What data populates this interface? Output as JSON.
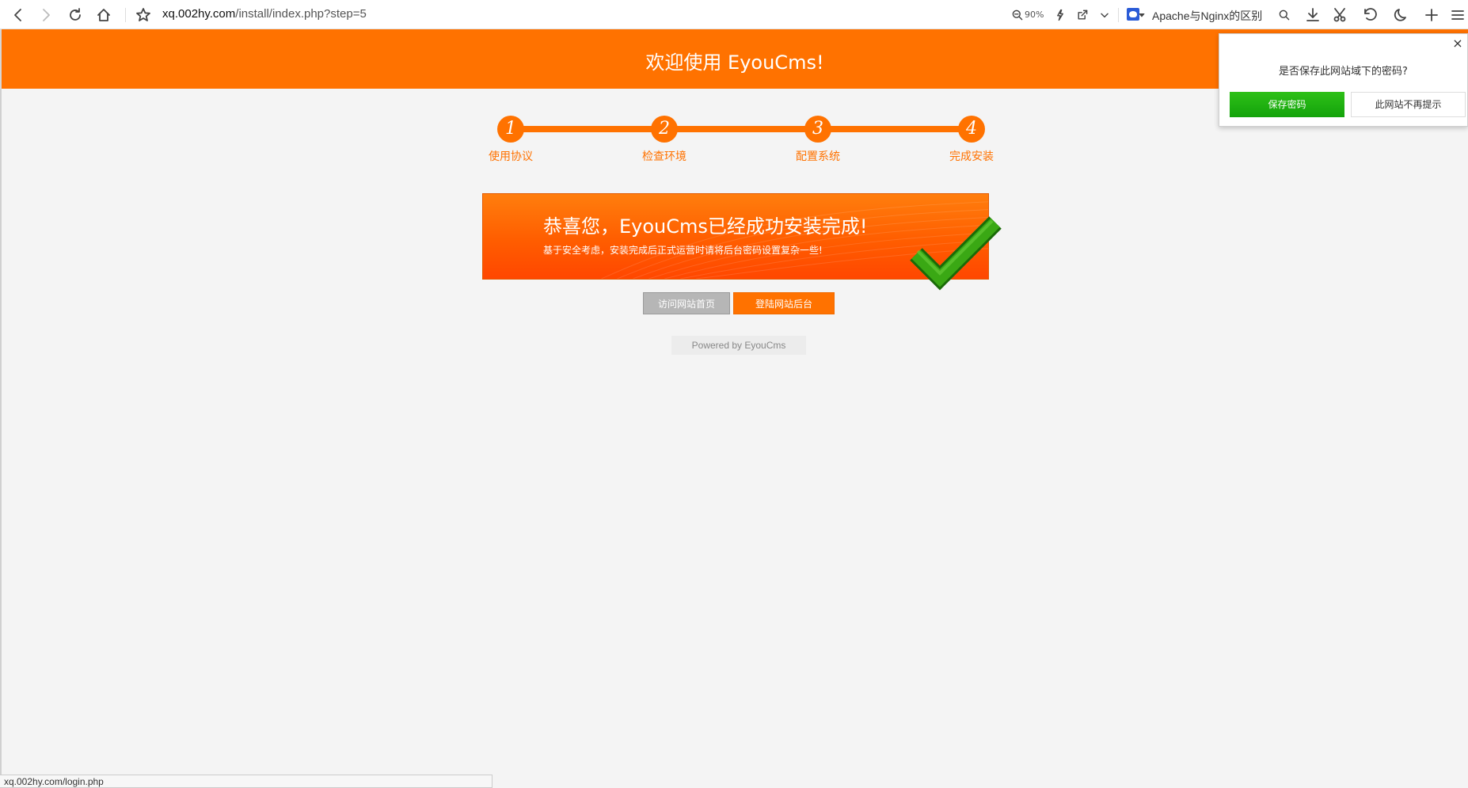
{
  "browser": {
    "url_host": "xq.002hy.com",
    "url_path": "/install/index.php?step=5",
    "zoom": "90%",
    "tab_title": "Apache与Nginx的区别",
    "status_url": "xq.002hy.com/login.php"
  },
  "header": {
    "title": "欢迎使用 EyouCms!"
  },
  "steps": [
    {
      "number": "1",
      "label": "使用协议"
    },
    {
      "number": "2",
      "label": "检查环境"
    },
    {
      "number": "3",
      "label": "配置系统"
    },
    {
      "number": "4",
      "label": "完成安装"
    }
  ],
  "banner": {
    "title": "恭喜您，EyouCms已经成功安装完成!",
    "subtitle": "基于安全考虑，安装完成后正式运营时请将后台密码设置复杂一些!"
  },
  "buttons": {
    "visit_home": "访问网站首页",
    "login_admin": "登陆网站后台"
  },
  "footer": {
    "powered": "Powered by EyouCms"
  },
  "password_popup": {
    "question": "是否保存此网站域下的密码?",
    "save": "保存密码",
    "never": "此网站不再提示",
    "close": "×"
  },
  "colors": {
    "brand_orange": "#ff7200",
    "save_green": "#1fb010",
    "check_green": "#2e9a10"
  }
}
